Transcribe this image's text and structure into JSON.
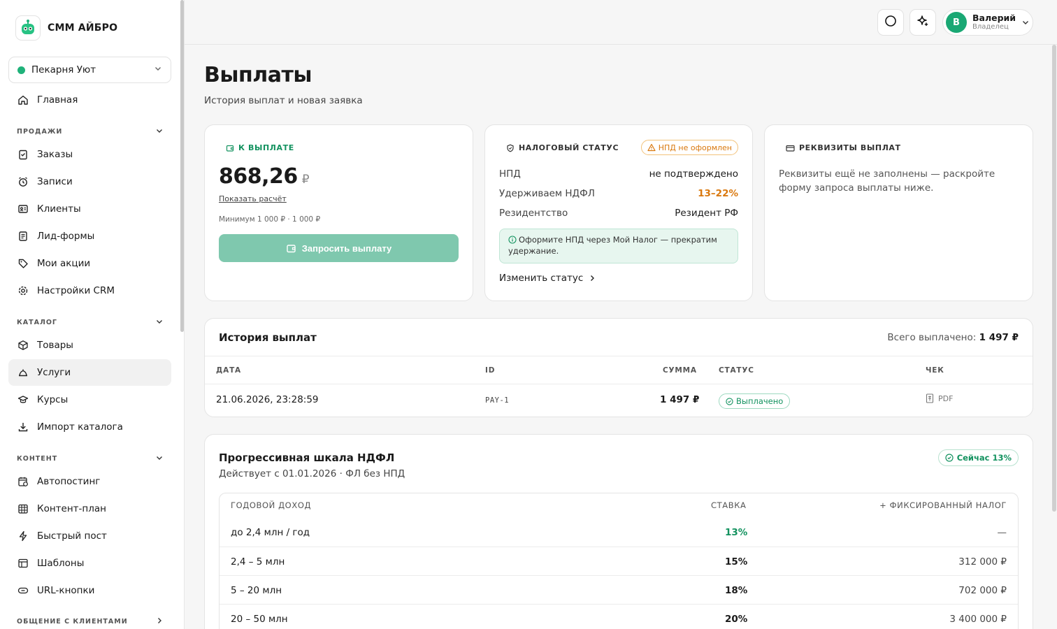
{
  "brand": {
    "name": "СММ АЙБРО"
  },
  "workspace": {
    "name": "Пекарня Уют",
    "status_color": "#1fb27a"
  },
  "sidebar": {
    "home": "Главная",
    "sections": [
      {
        "title": "ПРОДАЖИ",
        "items": [
          "Заказы",
          "Записи",
          "Клиенты",
          "Лид-формы",
          "Мои акции",
          "Настройки CRM"
        ]
      },
      {
        "title": "КАТАЛОГ",
        "items": [
          "Товары",
          "Услуги",
          "Курсы",
          "Импорт каталога"
        ]
      },
      {
        "title": "КОНТЕНТ",
        "items": [
          "Автопостинг",
          "Контент-план",
          "Быстрый пост",
          "Шаблоны",
          "URL-кнопки"
        ]
      },
      {
        "title": "ОБЩЕНИЕ С КЛИЕНТАМИ",
        "items": []
      }
    ],
    "active_item": "Услуги"
  },
  "user": {
    "initial": "В",
    "name": "Валерий",
    "role": "Владелец"
  },
  "page": {
    "title": "Выплаты",
    "subtitle": "История выплат и новая заявка"
  },
  "payout": {
    "label": "К ВЫПЛАТЕ",
    "amount": "868,26",
    "currency": "₽",
    "show_calc": "Показать расчёт",
    "minimum": "Минимум 1 000 ₽ · 1 000 ₽",
    "button": "Запросить выплату"
  },
  "tax": {
    "label": "НАЛОГОВЫЙ СТАТУС",
    "badge": "НПД не оформлен",
    "rows": [
      {
        "key": "НПД",
        "value": "не подтверждено"
      },
      {
        "key": "Удерживаем НДФЛ",
        "value": "13–22%"
      },
      {
        "key": "Резидентство",
        "value": "Резидент РФ"
      }
    ],
    "info": "Оформите НПД через Мой Налог — прекратим удержание.",
    "change": "Изменить статус"
  },
  "requisites": {
    "label": "РЕКВИЗИТЫ ВЫПЛАТ",
    "text": "Реквизиты ещё не заполнены — раскройте форму запроса выплаты ниже."
  },
  "history": {
    "title": "История выплат",
    "total_label": "Всего выплачено:",
    "total_value": "1 497 ₽",
    "columns": [
      "ДАТА",
      "ID",
      "СУММА",
      "СТАТУС",
      "ЧЕК"
    ],
    "rows": [
      {
        "date": "21.06.2026, 23:28:59",
        "id": "PAY-1",
        "sum": "1 497 ₽",
        "status": "Выплачено",
        "receipt": "PDF"
      }
    ]
  },
  "scale": {
    "title": "Прогрессивная шкала НДФЛ",
    "subtitle": "Действует с 01.01.2026 · ФЛ без НПД",
    "now": "Сейчас 13%",
    "columns": [
      "ГОДОВОЙ ДОХОД",
      "СТАВКА",
      "+ ФИКСИРОВАННЫЙ НАЛОГ"
    ],
    "rows": [
      {
        "income": "до 2,4 млн / год",
        "rate": "13%",
        "fixed": "—"
      },
      {
        "income": "2,4 – 5 млн",
        "rate": "15%",
        "fixed": "312 000 ₽"
      },
      {
        "income": "5 – 20 млн",
        "rate": "18%",
        "fixed": "702 000 ₽"
      },
      {
        "income": "20 – 50 млн",
        "rate": "20%",
        "fixed": "3 400 000 ₽"
      }
    ]
  },
  "colors": {
    "accent": "#13925f",
    "warning": "#d9780e",
    "button_disabled": "#7fc8ae"
  }
}
